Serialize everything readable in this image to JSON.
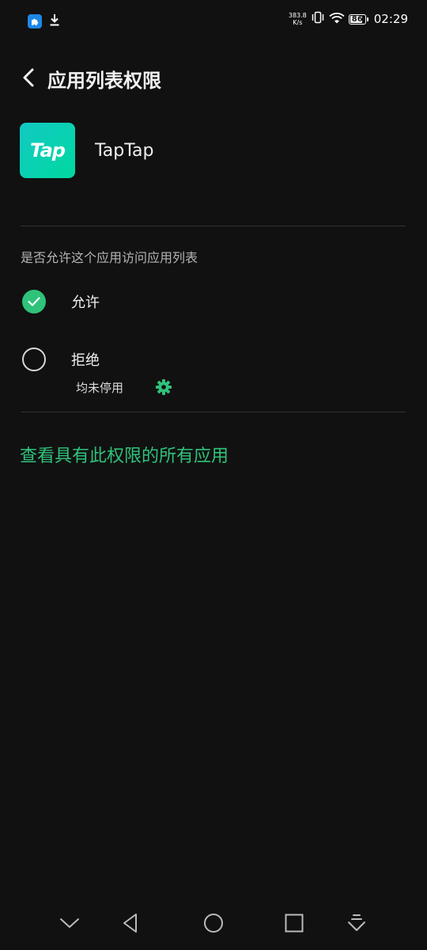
{
  "status_bar": {
    "net_speed_value": "383.8",
    "net_speed_unit": "K/s",
    "battery_level": "86",
    "time": "02:29",
    "left_icons": [
      "puzzle-icon",
      "download-icon"
    ],
    "right_icons": [
      "vibrate-icon",
      "wifi-icon",
      "battery-icon"
    ]
  },
  "header": {
    "title": "应用列表权限",
    "back_icon": "chevron-left-icon"
  },
  "app": {
    "name": "TapTap",
    "icon_text": "Tap",
    "icon_colors": [
      "#12c9c3",
      "#00d9a0"
    ]
  },
  "permission": {
    "question": "是否允许这个应用访问应用列表",
    "options": [
      {
        "label": "允许",
        "selected": true
      },
      {
        "label": "拒绝",
        "selected": false
      }
    ],
    "sub_label": "均未停用",
    "sub_icon": "gear-icon"
  },
  "view_all_link": "查看具有此权限的所有应用",
  "colors": {
    "background": "#111111",
    "accent": "#2fc27a",
    "divider": "#333333"
  },
  "nav_bar": {
    "buttons": [
      "collapse-icon",
      "back-triangle-icon",
      "home-circle-icon",
      "recents-square-icon",
      "notification-pull-icon"
    ]
  }
}
